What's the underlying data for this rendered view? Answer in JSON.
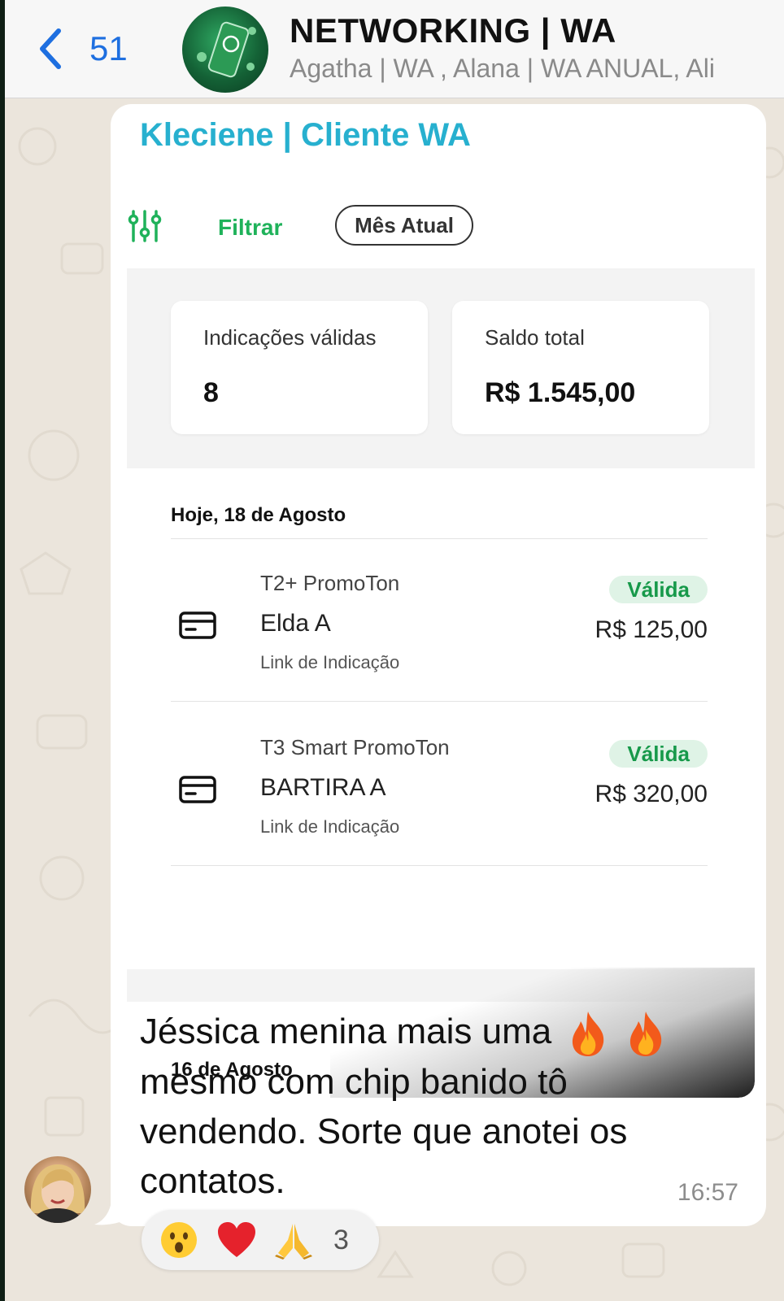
{
  "header": {
    "back_count": "51",
    "group_title": "NETWORKING | WA",
    "group_members": "Agatha | WA , Alana | WA ANUAL, Ali"
  },
  "message": {
    "sender": "Kleciene | Cliente WA",
    "text": "Jéssica menina mais uma",
    "text_rest": "mesmo com chip banido tô vendendo. Sorte que anotei os contatos.",
    "time": "16:57",
    "reactions": [
      "surprised-face",
      "red-heart",
      "folded-hands"
    ],
    "reaction_count": "3"
  },
  "screenshot": {
    "filter_label": "Filtrar",
    "period_chip": "Mês Atual",
    "summary": {
      "valid_referrals_label": "Indicações válidas",
      "valid_referrals_value": "8",
      "balance_label": "Saldo total",
      "balance_value": "R$ 1.545,00"
    },
    "days": [
      {
        "header": "Hoje, 18 de Agosto",
        "transactions": [
          {
            "product": "T2+ PromoTon",
            "name": "Elda A",
            "source": "Link de Indicação",
            "status": "Válida",
            "amount": "R$ 125,00"
          },
          {
            "product": "T3 Smart PromoTon",
            "name": "BARTIRA A",
            "source": "Link de Indicação",
            "status": "Válida",
            "amount": "R$ 320,00"
          }
        ]
      },
      {
        "header": "16 de Agosto",
        "transactions": []
      }
    ]
  },
  "colors": {
    "ios_blue": "#1e6fe0",
    "sender_name": "#27b0cf",
    "filter_green": "#1fb25a",
    "status_green": "#17994a",
    "status_bg": "#dff3e6"
  }
}
